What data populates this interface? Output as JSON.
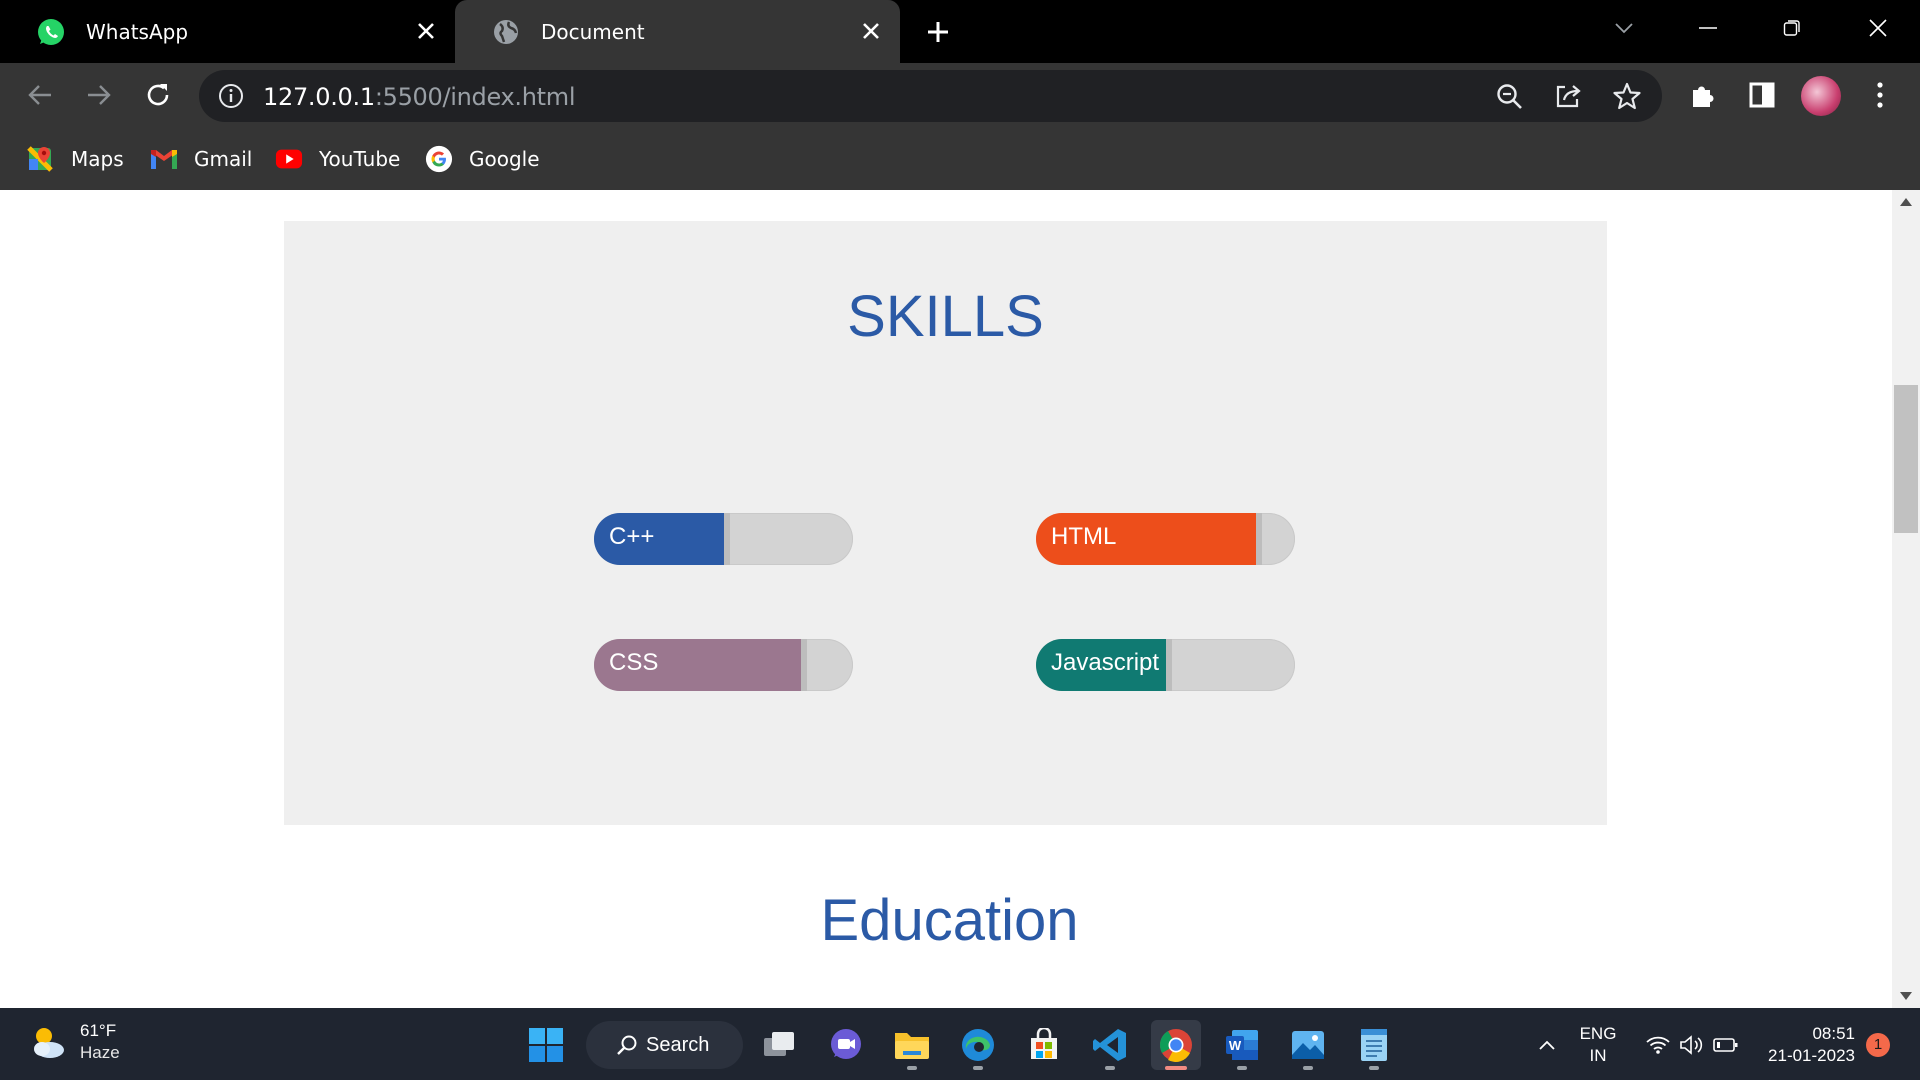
{
  "browser": {
    "tabs": [
      {
        "title": "WhatsApp",
        "icon": "whatsapp-icon",
        "active": false
      },
      {
        "title": "Document",
        "icon": "globe-icon",
        "active": true
      }
    ],
    "url_host": "127.0.0.1",
    "url_rest": ":5500/index.html",
    "bookmarks": [
      {
        "label": "Maps",
        "icon": "google-maps-icon"
      },
      {
        "label": "Gmail",
        "icon": "gmail-icon"
      },
      {
        "label": "YouTube",
        "icon": "youtube-icon"
      },
      {
        "label": "Google",
        "icon": "google-icon"
      }
    ]
  },
  "page": {
    "skills_title": "SKILLS",
    "skills": [
      {
        "label": "C++",
        "level": 0.5,
        "color": "#2b5aa6"
      },
      {
        "label": "HTML",
        "level": 0.85,
        "color": "#ed4e1b"
      },
      {
        "label": "CSS",
        "level": 0.8,
        "color": "#9b778f"
      },
      {
        "label": "Javascript",
        "level": 0.5,
        "color": "#107a72"
      }
    ],
    "education_title": "Education",
    "accent_color": "#2b5aa6"
  },
  "taskbar": {
    "weather_temp": "61°F",
    "weather_cond": "Haze",
    "search_label": "Search",
    "lang_top": "ENG",
    "lang_bottom": "IN",
    "time": "08:51",
    "date": "21-01-2023",
    "notifications": "1",
    "apps": [
      "windows-start-icon",
      "task-view-icon",
      "teams-chat-icon",
      "file-explorer-icon",
      "edge-icon",
      "microsoft-store-icon",
      "vscode-icon",
      "chrome-icon",
      "word-icon",
      "photos-icon",
      "notepad-icon"
    ]
  }
}
